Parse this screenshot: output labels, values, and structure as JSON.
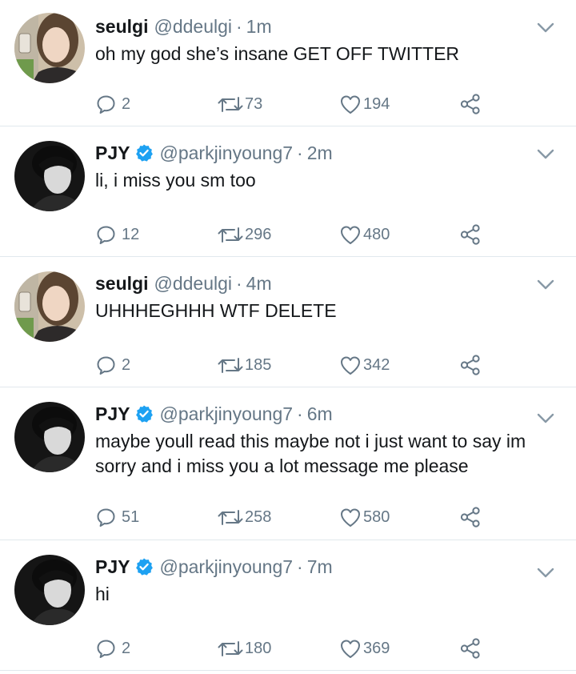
{
  "tweets": [
    {
      "name": "seulgi",
      "verified": false,
      "handle": "@ddeulgi",
      "separator": "·",
      "time": "1m",
      "text": "oh my god she’s insane GET OFF TWITTER",
      "replies": "2",
      "retweets": "73",
      "likes": "194"
    },
    {
      "name": "PJY",
      "verified": true,
      "handle": "@parkjinyoung7",
      "separator": "·",
      "time": "2m",
      "text": "li, i miss you sm too",
      "replies": "12",
      "retweets": "296",
      "likes": "480"
    },
    {
      "name": "seulgi",
      "verified": false,
      "handle": "@ddeulgi",
      "separator": "·",
      "time": "4m",
      "text": "UHHHEGHHH WTF DELETE",
      "replies": "2",
      "retweets": "185",
      "likes": "342"
    },
    {
      "name": "PJY",
      "verified": true,
      "handle": "@parkjinyoung7",
      "separator": "·",
      "time": "6m",
      "text": "maybe youll read this maybe not i just want to say im sorry and i miss you a lot message me please",
      "replies": "51",
      "retweets": "258",
      "likes": "580"
    },
    {
      "name": "PJY",
      "verified": true,
      "handle": "@parkjinyoung7",
      "separator": "·",
      "time": "7m",
      "text": "hi",
      "replies": "2",
      "retweets": "180",
      "likes": "369"
    }
  ],
  "colors": {
    "verified": "#1da1f2",
    "secondary_text": "#657786",
    "divider": "#e1e8ed"
  },
  "icons": {
    "reply": "reply-icon",
    "retweet": "retweet-icon",
    "like": "heart-icon",
    "share": "share-icon",
    "menu": "chevron-down-icon",
    "verified": "verified-badge-icon"
  }
}
